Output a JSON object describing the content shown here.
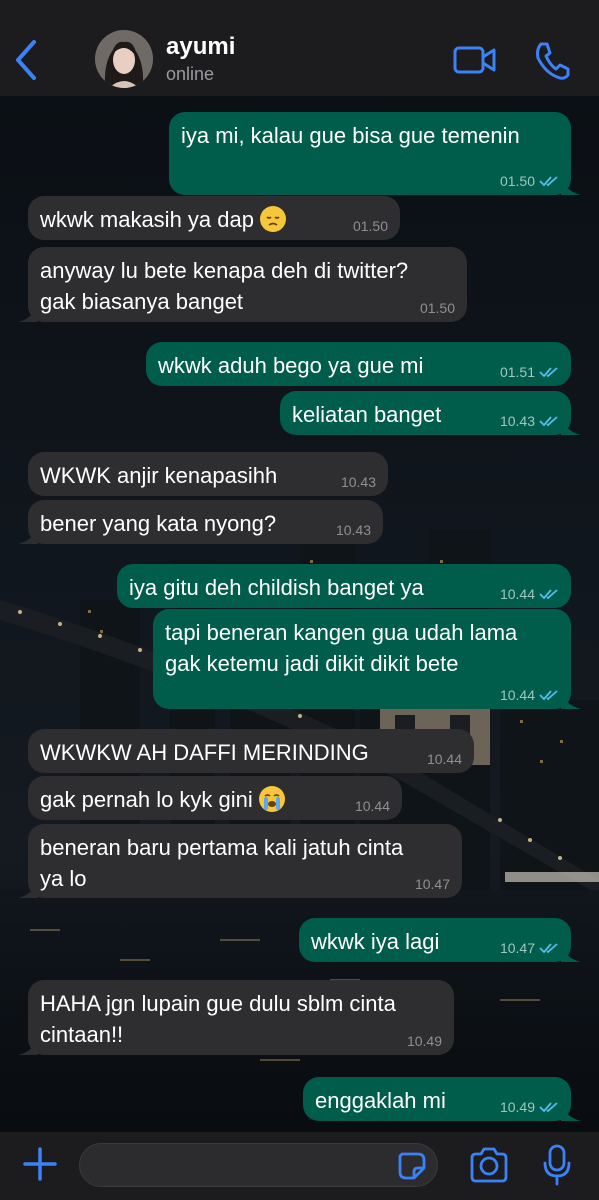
{
  "header": {
    "contact_name": "ayumi",
    "contact_status": "online"
  },
  "messages": [
    {
      "direction": "out",
      "text": [
        "iya mi, kalau gue bisa gue temenin"
      ],
      "time": "01.50",
      "read": true
    },
    {
      "direction": "in",
      "text": [
        "wkwk makasih ya dap"
      ],
      "emoji": "pensive-face-emoji",
      "time": "01.50"
    },
    {
      "direction": "in",
      "text": [
        "anyway lu bete kenapa deh di twitter?",
        "gak biasanya banget"
      ],
      "time": "01.50"
    },
    {
      "direction": "out",
      "text": [
        "wkwk aduh bego ya gue mi"
      ],
      "time": "01.51",
      "read": true
    },
    {
      "direction": "out",
      "text": [
        "keliatan banget"
      ],
      "time": "10.43",
      "read": true
    },
    {
      "direction": "in",
      "text": [
        "WKWK anjir kenapasihh"
      ],
      "time": "10.43"
    },
    {
      "direction": "in",
      "text": [
        "bener yang kata nyong?"
      ],
      "time": "10.43"
    },
    {
      "direction": "out",
      "text": [
        "iya gitu deh childish banget ya"
      ],
      "time": "10.44",
      "read": true
    },
    {
      "direction": "out",
      "text": [
        "tapi beneran kangen gua udah lama",
        "gak ketemu jadi dikit dikit bete"
      ],
      "time": "10.44",
      "read": true
    },
    {
      "direction": "in",
      "text": [
        "WKWKW AH DAFFI MERINDING"
      ],
      "time": "10.44"
    },
    {
      "direction": "in",
      "text": [
        "gak pernah lo kyk gini"
      ],
      "emoji": "loudly-crying-face-emoji",
      "time": "10.44"
    },
    {
      "direction": "in",
      "text": [
        "beneran baru pertama kali jatuh cinta",
        "ya lo"
      ],
      "time": "10.47"
    },
    {
      "direction": "out",
      "text": [
        "wkwk iya lagi"
      ],
      "time": "10.47",
      "read": true
    },
    {
      "direction": "in",
      "text": [
        "HAHA jgn lupain gue dulu sblm cinta",
        "cintaan!!"
      ],
      "time": "10.49"
    },
    {
      "direction": "out",
      "text": [
        "enggaklah mi"
      ],
      "time": "10.49",
      "read": true
    }
  ],
  "composer": {
    "placeholder": ""
  },
  "colors": {
    "outgoing_bubble": "#005c4b",
    "incoming_bubble": "#2e2e30",
    "accent": "#3b82f6",
    "read_ticks": "#53bdeb"
  }
}
